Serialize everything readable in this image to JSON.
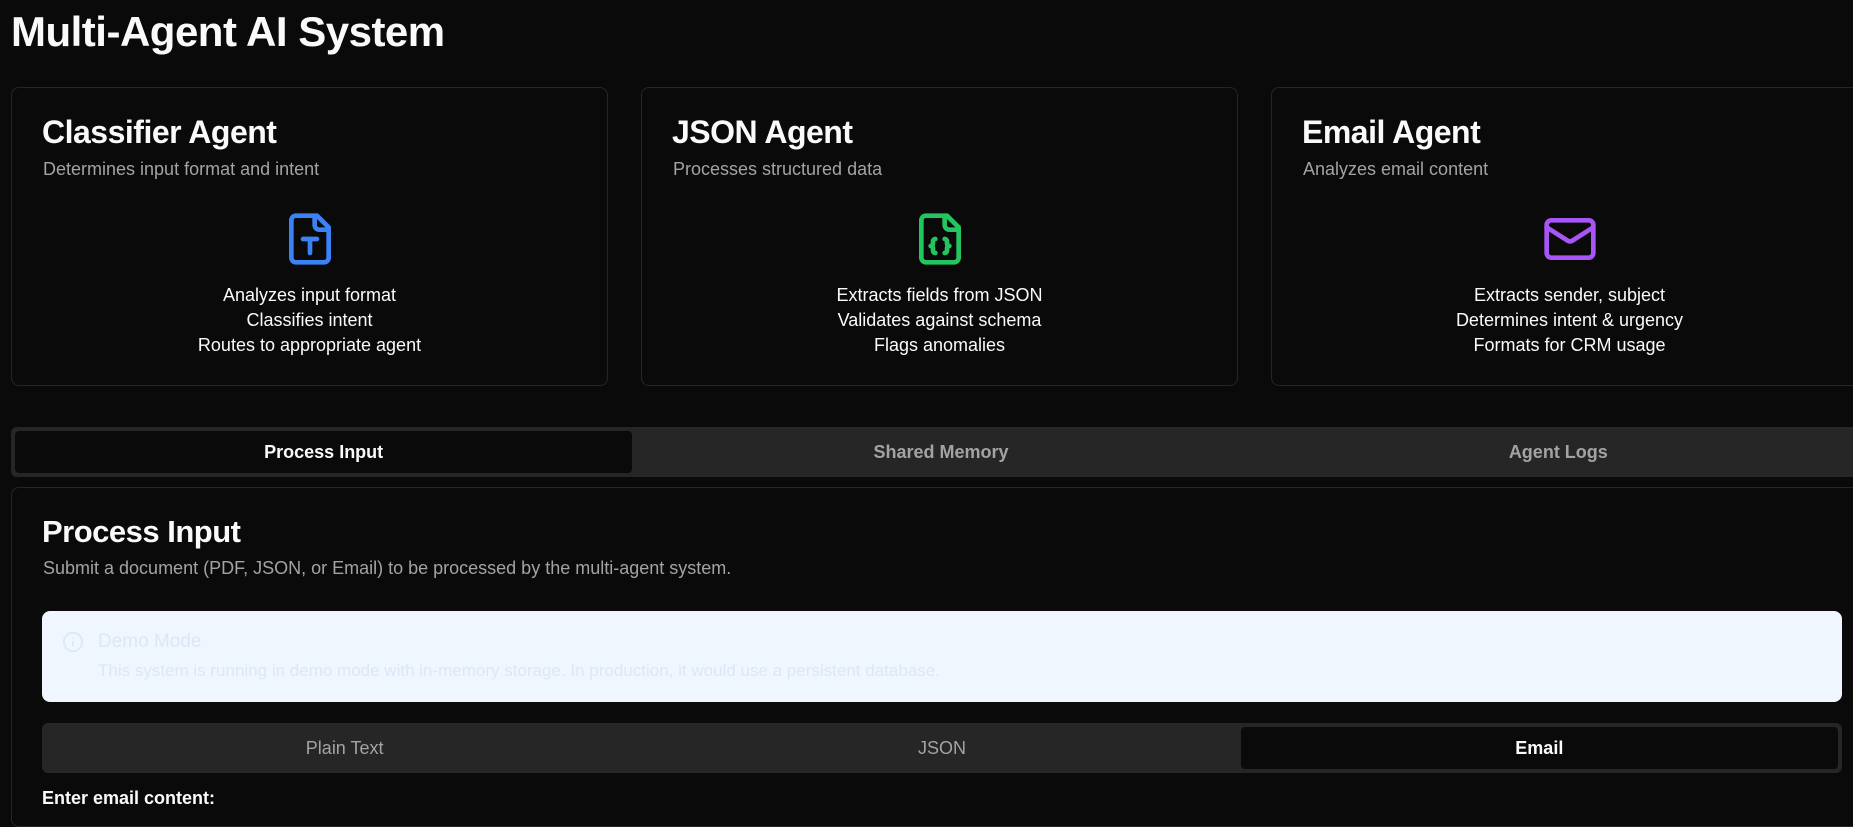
{
  "app": {
    "title": "Multi-Agent AI System"
  },
  "agents": [
    {
      "title": "Classifier Agent",
      "description": "Determines input format and intent",
      "icon": "file-text-icon",
      "icon_color": "#3b82f6",
      "features": [
        "Analyzes input format",
        "Classifies intent",
        "Routes to appropriate agent"
      ]
    },
    {
      "title": "JSON Agent",
      "description": "Processes structured data",
      "icon": "file-json-icon",
      "icon_color": "#22c55e",
      "features": [
        "Extracts fields from JSON",
        "Validates against schema",
        "Flags anomalies"
      ]
    },
    {
      "title": "Email Agent",
      "description": "Analyzes email content",
      "icon": "mail-icon",
      "icon_color": "#a855f7",
      "features": [
        "Extracts sender, subject",
        "Determines intent & urgency",
        "Formats for CRM usage"
      ]
    }
  ],
  "tabs": [
    {
      "label": "Process Input",
      "active": true
    },
    {
      "label": "Shared Memory",
      "active": false
    },
    {
      "label": "Agent Logs",
      "active": false
    }
  ],
  "process": {
    "title": "Process Input",
    "description": "Submit a document (PDF, JSON, or Email) to be processed by the multi-agent system.",
    "alert": {
      "icon": "info-circle-icon",
      "title": "Demo Mode",
      "text": "This system is running in demo mode with in-memory storage. In production, it would use a persistent database."
    },
    "input_tabs": [
      {
        "label": "Plain Text",
        "active": false
      },
      {
        "label": "JSON",
        "active": false
      },
      {
        "label": "Email",
        "active": true
      }
    ],
    "field_label": "Enter email content:"
  }
}
